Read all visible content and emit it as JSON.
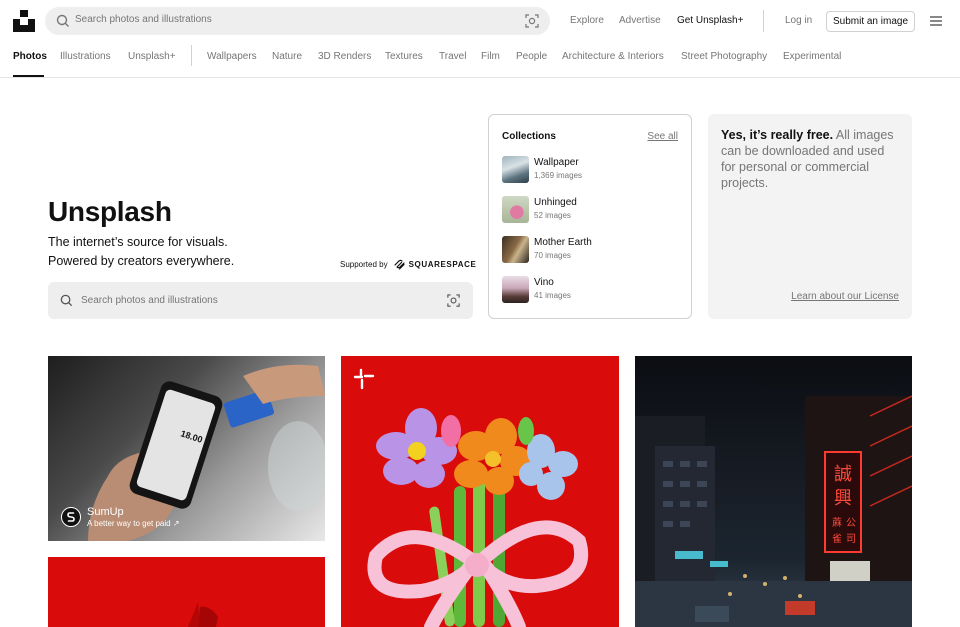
{
  "header": {
    "search_placeholder": "Search photos and illustrations",
    "nav": {
      "explore": "Explore",
      "advertise": "Advertise",
      "get_plus": "Get Unsplash+"
    },
    "login": "Log in",
    "submit": "Submit an image",
    "icons": {
      "logo": "unsplash-logo",
      "search": "search-icon",
      "visual_search": "visual-search-icon",
      "menu": "menu-icon"
    }
  },
  "categories": {
    "primary": [
      "Photos",
      "Illustrations",
      "Unsplash+"
    ],
    "topics": [
      "Wallpapers",
      "Nature",
      "3D Renders",
      "Textures",
      "Travel",
      "Film",
      "People",
      "Architecture & Interiors",
      "Street Photography",
      "Experimental"
    ],
    "active": "Photos"
  },
  "hero": {
    "title": "Unsplash",
    "subtitle_line1": "The internet’s source for visuals.",
    "subtitle_line2": "Powered by creators everywhere.",
    "supported_by": "Supported by",
    "sponsor_brand": "SQUARESPACE",
    "search_placeholder": "Search photos and illustrations"
  },
  "collections": {
    "title": "Collections",
    "see_all": "See all",
    "items": [
      {
        "name": "Wallpaper",
        "count": "1,369 images"
      },
      {
        "name": "Unhinged",
        "count": "52 images"
      },
      {
        "name": "Mother Earth",
        "count": "70 images"
      },
      {
        "name": "Vino",
        "count": "41 images"
      }
    ]
  },
  "license": {
    "bold": "Yes, it’s really free.",
    "text": " All images can be downloaded and used for personal or commercial projects.",
    "link": "Learn about our License"
  },
  "feed": {
    "sponsored": {
      "name": "SumUp",
      "tagline": "A better way to get paid ↗"
    }
  },
  "colors": {
    "accent_red": "#d90b0b",
    "text_primary": "#111111",
    "text_secondary": "#767676"
  }
}
